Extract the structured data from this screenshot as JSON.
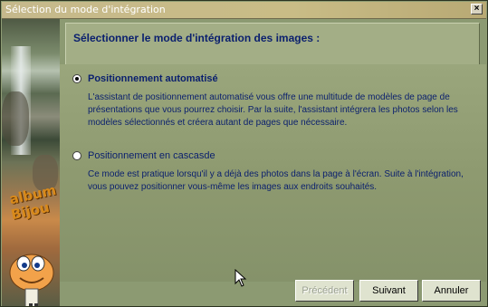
{
  "window": {
    "title": "Sélection du mode d'intégration",
    "close_label": "×"
  },
  "branding": {
    "logo_word1": "album",
    "logo_word2": "Bijou"
  },
  "header": {
    "title": "Sélectionner le mode d'intégration des images :"
  },
  "options": [
    {
      "label": "Positionnement automatisé",
      "selected": true,
      "description": "L'assistant de positionnement automatisé vous offre une multitude de modèles de page de présentations que vous pourrez choisir. Par la suite, l'assistant intégrera les photos selon les modèles sélectionnés et créera autant de pages que nécessaire."
    },
    {
      "label": "Positionnement en cascasde",
      "selected": false,
      "description": "Ce mode est pratique lorsqu'il y a déjà des photos dans la page à l'écran. Suite à l'intégration, vous pouvez positionner vous-même les images aux endroits souhaités."
    }
  ],
  "buttons": {
    "previous": "Précédent",
    "next": "Suivant",
    "cancel": "Annuler"
  },
  "colors": {
    "text_blue": "#0a1f6e",
    "panel": "#8c9a72",
    "title_bar": "#c6b98c"
  }
}
